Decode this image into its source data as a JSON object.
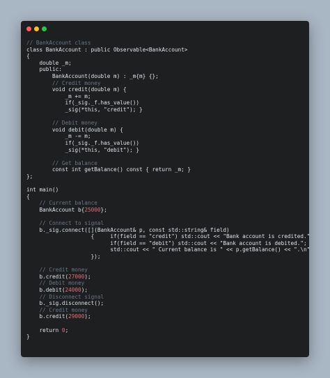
{
  "window": {
    "buttons": [
      "close",
      "minimize",
      "maximize"
    ]
  },
  "code_lines": [
    [
      {
        "t": "// BankAccount class",
        "c": "cmt"
      }
    ],
    [
      {
        "t": "class BankAccount : public Observable<BankAccount>"
      }
    ],
    [
      {
        "t": "{"
      }
    ],
    [
      {
        "t": "    double _m;"
      }
    ],
    [
      {
        "t": "    public:"
      }
    ],
    [
      {
        "t": "        BankAccount(double m) : _m{m} {};"
      }
    ],
    [
      {
        "t": "        // Credit money",
        "c": "cmt"
      }
    ],
    [
      {
        "t": "        void credit(double m) {"
      }
    ],
    [
      {
        "t": "            _m += m;"
      }
    ],
    [
      {
        "t": "            if(_sig._f.has_value())"
      }
    ],
    [
      {
        "t": "            _sig(*this, \"credit\"); }"
      }
    ],
    [
      {
        "t": ""
      }
    ],
    [
      {
        "t": "        // Debit money",
        "c": "cmt"
      }
    ],
    [
      {
        "t": "        void debit(double m) {"
      }
    ],
    [
      {
        "t": "            _m -= m;"
      }
    ],
    [
      {
        "t": "            if(_sig._f.has_value())"
      }
    ],
    [
      {
        "t": "            _sig(*this, \"debit\"); }"
      }
    ],
    [
      {
        "t": ""
      }
    ],
    [
      {
        "t": "        // Get balance",
        "c": "cmt"
      }
    ],
    [
      {
        "t": "        const int getBalance() const { return _m; }"
      }
    ],
    [
      {
        "t": "};"
      }
    ],
    [
      {
        "t": ""
      }
    ],
    [
      {
        "t": "int main()"
      }
    ],
    [
      {
        "t": "{"
      }
    ],
    [
      {
        "t": "    // Current balance",
        "c": "cmt"
      }
    ],
    [
      {
        "t": "    BankAccount b{"
      },
      {
        "t": "25000",
        "c": "num"
      },
      {
        "t": "};"
      }
    ],
    [
      {
        "t": ""
      }
    ],
    [
      {
        "t": "    // Connect to signal",
        "c": "cmt"
      }
    ],
    [
      {
        "t": "    b._sig.connect([](BankAccount& p, const std::string& field)"
      }
    ],
    [
      {
        "t": "                    {     if(field == \"credit\") std::cout << \"Bank account is credited.\";"
      }
    ],
    [
      {
        "t": "                          if(field == \"debit\") std::cout << \"Bank account is debited.\";"
      }
    ],
    [
      {
        "t": "                          std::cout << \" Current balance is \" << p.getBalance() << \".\\n\";"
      }
    ],
    [
      {
        "t": "                    });"
      }
    ],
    [
      {
        "t": ""
      }
    ],
    [
      {
        "t": "    // Credit money",
        "c": "cmt"
      }
    ],
    [
      {
        "t": "    b.credit("
      },
      {
        "t": "27000",
        "c": "num"
      },
      {
        "t": ");"
      }
    ],
    [
      {
        "t": "    // Debit money",
        "c": "cmt"
      }
    ],
    [
      {
        "t": "    b.debit("
      },
      {
        "t": "24000",
        "c": "num"
      },
      {
        "t": ");"
      }
    ],
    [
      {
        "t": "    // Disconnect signal",
        "c": "cmt"
      }
    ],
    [
      {
        "t": "    b._sig.disconnect();"
      }
    ],
    [
      {
        "t": "    // Credit money",
        "c": "cmt"
      }
    ],
    [
      {
        "t": "    b.credit("
      },
      {
        "t": "29000",
        "c": "num"
      },
      {
        "t": ");"
      }
    ],
    [
      {
        "t": ""
      }
    ],
    [
      {
        "t": "    return "
      },
      {
        "t": "0",
        "c": "num"
      },
      {
        "t": ";"
      }
    ],
    [
      {
        "t": "}"
      }
    ]
  ],
  "colors": {
    "background": "#a9b6c3",
    "window": "#1e1f21",
    "text": "#dfe3ea",
    "comment": "#6b7586",
    "number": "#e06c75",
    "close": "#ff5f57",
    "minimize": "#febc2e",
    "maximize": "#28c840"
  }
}
